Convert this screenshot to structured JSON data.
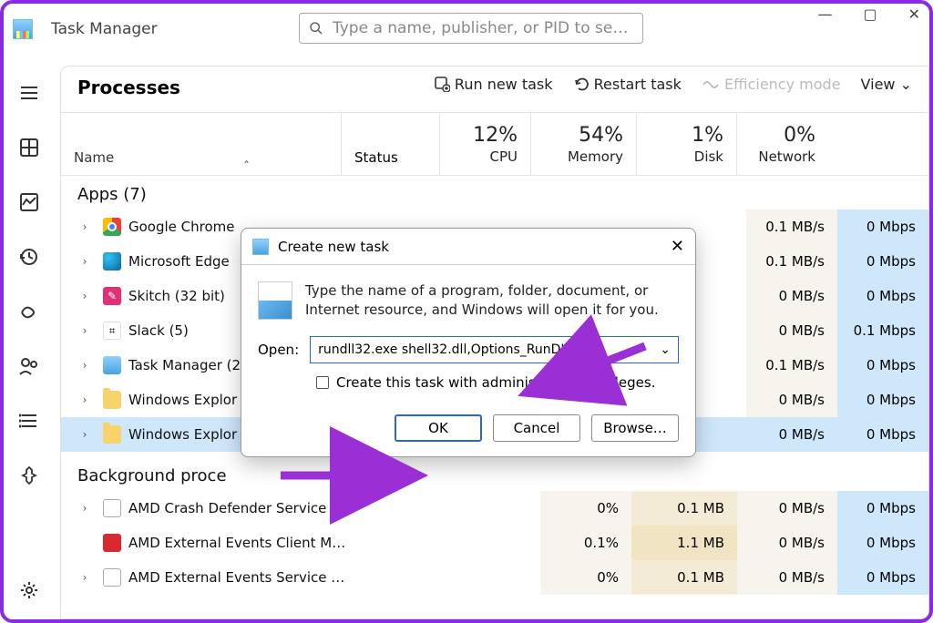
{
  "window": {
    "title": "Task Manager",
    "search_placeholder": "Type a name, publisher, or PID to se…"
  },
  "page": {
    "title": "Processes",
    "toolbar": {
      "run_new_task": "Run new task",
      "restart_task": "Restart task",
      "efficiency_mode": "Efficiency mode",
      "view": "View"
    }
  },
  "columns": {
    "name": "Name",
    "status": "Status",
    "cpu": {
      "pct": "12%",
      "label": "CPU"
    },
    "memory": {
      "pct": "54%",
      "label": "Memory"
    },
    "disk": {
      "pct": "1%",
      "label": "Disk"
    },
    "network": {
      "pct": "0%",
      "label": "Network"
    }
  },
  "groups": {
    "apps": "Apps (7)",
    "background": "Background proce"
  },
  "rows": [
    {
      "name": "Google Chrome",
      "disk": "0.1 MB/s",
      "net": "0 Mbps"
    },
    {
      "name": "Microsoft Edge",
      "disk": "0.1 MB/s",
      "net": "0 Mbps"
    },
    {
      "name": "Skitch (32 bit)",
      "disk": "0 MB/s",
      "net": "0 Mbps"
    },
    {
      "name": "Slack (5)",
      "disk": "0 MB/s",
      "net": "0.1 Mbps"
    },
    {
      "name": "Task Manager (2",
      "disk": "0.1 MB/s",
      "net": "0 Mbps"
    },
    {
      "name": "Windows Explor",
      "disk": "0 MB/s",
      "net": "0 Mbps"
    },
    {
      "name": "Windows Explor",
      "disk": "0 MB/s",
      "net": "0 Mbps"
    }
  ],
  "bgrows": [
    {
      "name": "AMD Crash Defender Service",
      "cpu": "0%",
      "mem": "0.1 MB",
      "disk": "0 MB/s",
      "net": "0 Mbps"
    },
    {
      "name": "AMD External Events Client M…",
      "cpu": "0.1%",
      "mem": "1.1 MB",
      "disk": "0 MB/s",
      "net": "0 Mbps"
    },
    {
      "name": "AMD External Events Service …",
      "cpu": "0%",
      "mem": "0.1 MB",
      "disk": "0 MB/s",
      "net": "0 Mbps"
    }
  ],
  "dialog": {
    "title": "Create new task",
    "intro": "Type the name of a program, folder, document, or Internet resource, and Windows will open it for you.",
    "open_label": "Open:",
    "open_value": "rundll32.exe shell32.dll,Options_RunDLL 0",
    "admin_label": "Create this task with administrative privileges.",
    "ok": "OK",
    "cancel": "Cancel",
    "browse": "Browse…"
  }
}
